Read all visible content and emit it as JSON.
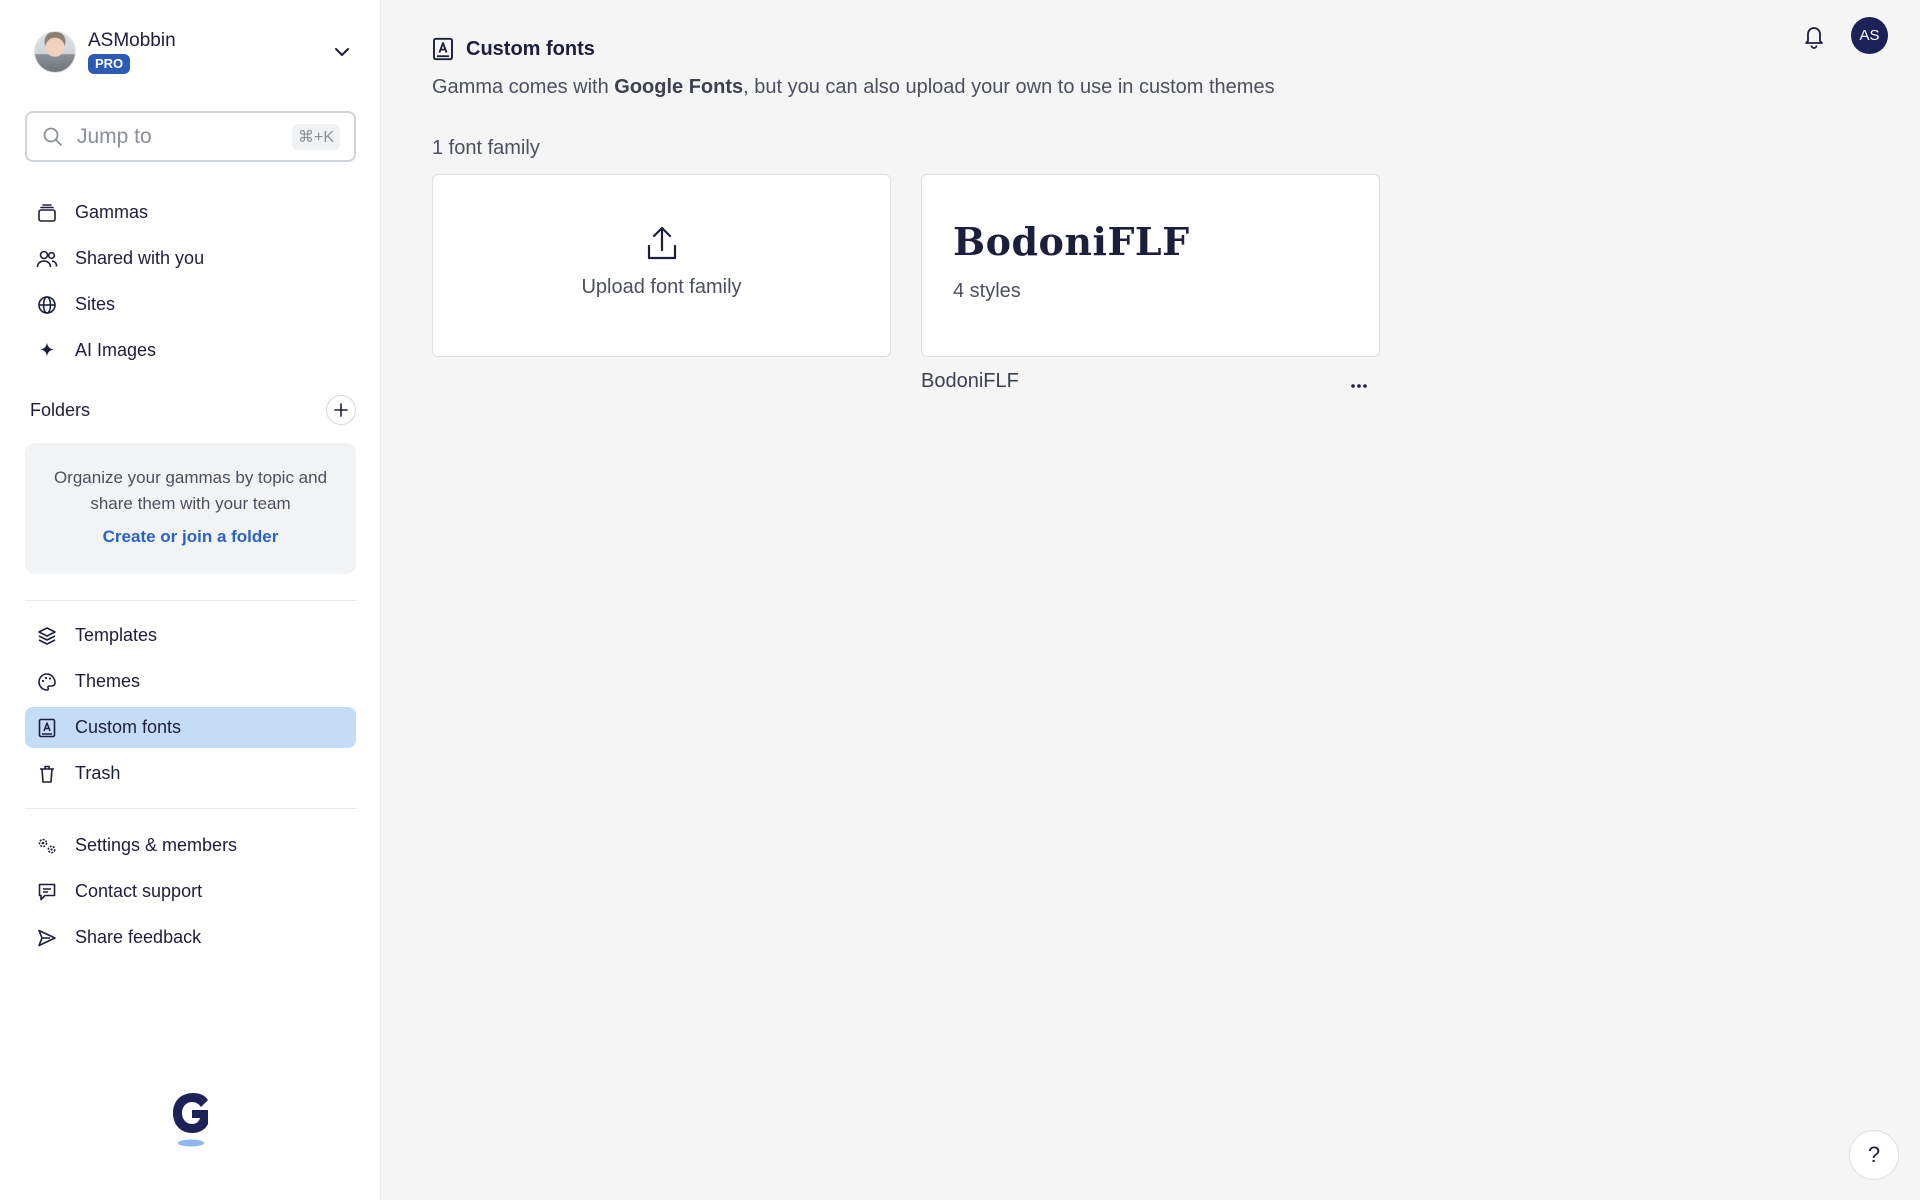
{
  "account": {
    "name": "ASMobbin",
    "plan_badge": "PRO"
  },
  "search": {
    "placeholder": "Jump to",
    "shortcut": "⌘+K"
  },
  "nav_primary": [
    {
      "label": "Gammas",
      "icon": "stack-icon"
    },
    {
      "label": "Shared with you",
      "icon": "users-icon"
    },
    {
      "label": "Sites",
      "icon": "globe-icon"
    },
    {
      "label": "AI Images",
      "icon": "sparkle-icon"
    }
  ],
  "folders": {
    "title": "Folders",
    "hint": "Organize your gammas by topic and share them with your team",
    "link": "Create or join a folder"
  },
  "nav_secondary": [
    {
      "label": "Templates",
      "icon": "layers-icon"
    },
    {
      "label": "Themes",
      "icon": "palette-icon"
    },
    {
      "label": "Custom fonts",
      "icon": "font-book-icon",
      "active": true
    },
    {
      "label": "Trash",
      "icon": "trash-icon"
    }
  ],
  "nav_footer": [
    {
      "label": "Settings & members",
      "icon": "gears-icon"
    },
    {
      "label": "Contact support",
      "icon": "chat-icon"
    },
    {
      "label": "Share feedback",
      "icon": "send-icon"
    }
  ],
  "main": {
    "title": "Custom fonts",
    "subtitle_pre": "Gamma comes with ",
    "subtitle_bold": "Google Fonts",
    "subtitle_post": ", but you can also upload your own to use in custom themes",
    "count": "1 font family",
    "upload_label": "Upload font family",
    "fonts": [
      {
        "name": "BodoniFLF",
        "styles": "4 styles",
        "caption": "BodoniFLF"
      }
    ],
    "more_label": "..."
  },
  "topbar": {
    "user_initials": "AS"
  },
  "help_label": "?",
  "colors": {
    "accent": "#2a62c9",
    "active_nav": "#c5dcf6",
    "avatar_bg": "#1c2158",
    "badge": "#2a5bb5"
  }
}
